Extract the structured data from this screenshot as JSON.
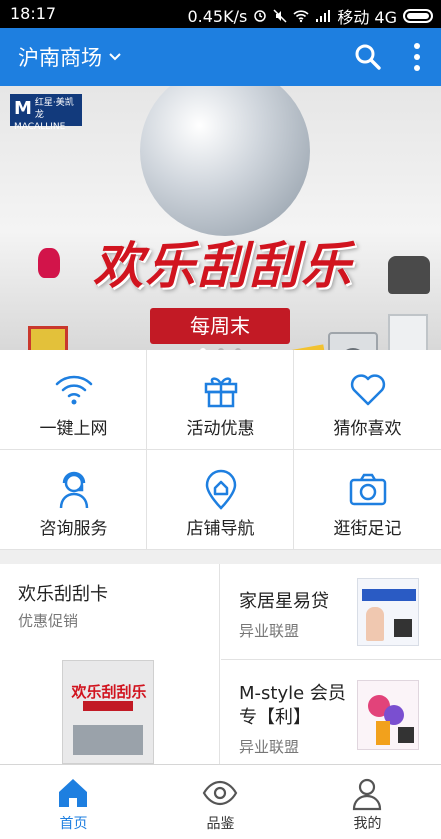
{
  "status_bar": {
    "time": "18:17",
    "speed": "0.45K/s",
    "carrier": "移动 4G"
  },
  "header": {
    "title": "沪南商场",
    "search_icon": "search-icon",
    "more_icon": "more-vertical-icon",
    "background_color": "#1e7fe0"
  },
  "banner": {
    "brand": "红星·美凯龙",
    "brand_en": "MACALLINE",
    "brand_mark": "M",
    "title": "欢乐刮刮乐",
    "subtitle": "每周末",
    "page_count": 3,
    "active_page": 1
  },
  "grid": {
    "items": [
      {
        "label": "一键上网",
        "icon": "wifi-icon"
      },
      {
        "label": "活动优惠",
        "icon": "gift-icon"
      },
      {
        "label": "猜你喜欢",
        "icon": "heart-icon"
      },
      {
        "label": "咨询服务",
        "icon": "headset-icon"
      },
      {
        "label": "店铺导航",
        "icon": "map-pin-icon"
      },
      {
        "label": "逛街足记",
        "icon": "camera-icon"
      }
    ]
  },
  "promotions": {
    "left": {
      "title": "欢乐刮刮卡",
      "subtitle": "优惠促销",
      "thumb_text": "欢乐刮刮乐"
    },
    "right": [
      {
        "title": "家居星易贷",
        "subtitle": "异业联盟"
      },
      {
        "title": "M-style 会员专【利】",
        "subtitle": "异业联盟"
      }
    ]
  },
  "bottom_nav": {
    "items": [
      {
        "label": "首页",
        "icon": "home-icon",
        "active": true
      },
      {
        "label": "品鉴",
        "icon": "eye-icon",
        "active": false
      },
      {
        "label": "我的",
        "icon": "user-icon",
        "active": false
      }
    ],
    "accent": "#1e7fe0"
  }
}
